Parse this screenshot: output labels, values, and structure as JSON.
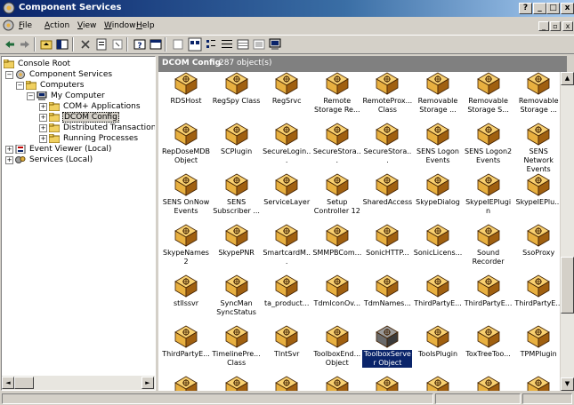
{
  "window": {
    "title": "Component Services",
    "controls": {
      "help": "?",
      "minimize": "_",
      "maximize": "□",
      "close": "x"
    }
  },
  "menu": {
    "items": [
      {
        "label": "File",
        "underline": "F",
        "rest": "ile"
      },
      {
        "label": "Action",
        "underline": "A",
        "rest": "ction"
      },
      {
        "label": "View",
        "underline": "V",
        "rest": "iew"
      },
      {
        "label": "Window",
        "underline": "W",
        "rest": "indow"
      },
      {
        "label": "Help",
        "underline": "H",
        "rest": "elp"
      }
    ],
    "mdi": {
      "minimize": "_",
      "restore": "▫",
      "close": "x"
    }
  },
  "toolbar": {
    "icons": [
      "back-icon",
      "forward-icon",
      "up-folder-icon",
      "show-tree-icon",
      "delete-icon",
      "properties-icon",
      "refresh-icon",
      "help-icon",
      "console-icon",
      "new-window-icon",
      "large-icons-icon",
      "small-icons-icon",
      "list-view-icon",
      "detail-view-icon",
      "status-icon",
      "computer-icon"
    ]
  },
  "tree": {
    "items": [
      {
        "label": "Console Root",
        "level": 0,
        "icon": "folder",
        "expander": ""
      },
      {
        "label": "Component Services",
        "level": 1,
        "icon": "gear",
        "expander": "−"
      },
      {
        "label": "Computers",
        "level": 2,
        "icon": "folder",
        "expander": "−"
      },
      {
        "label": "My Computer",
        "level": 3,
        "icon": "computer",
        "expander": "−"
      },
      {
        "label": "COM+ Applications",
        "level": 4,
        "icon": "folder",
        "expander": "+"
      },
      {
        "label": "DCOM Config",
        "level": 4,
        "icon": "folder",
        "expander": "+",
        "selected": true
      },
      {
        "label": "Distributed Transaction C",
        "level": 4,
        "icon": "folder",
        "expander": "+"
      },
      {
        "label": "Running Processes",
        "level": 4,
        "icon": "folder",
        "expander": "+"
      },
      {
        "label": "Event Viewer (Local)",
        "level": 0,
        "icon": "event",
        "expander": "+"
      },
      {
        "label": "Services (Local)",
        "level": 0,
        "icon": "services",
        "expander": "+"
      }
    ]
  },
  "list": {
    "title": "DCOM Config",
    "count": "287 object(s)",
    "items": [
      "RDSHost",
      "RegSpy Class",
      "RegSrvc",
      "Remote Storage Re...",
      "RemoteProx... Class",
      "Removable Storage ...",
      "Removable Storage S...",
      "Removable Storage ...",
      "RepDoseMDB Object",
      "SCPlugin",
      "SecureLogin...",
      "SecureStora...",
      "SecureStora...",
      "SENS Logon Events",
      "SENS Logon2 Events",
      "SENS Network Events",
      "SENS OnNow Events",
      "SENS Subscriber ...",
      "ServiceLayer",
      "Setup Controller 12",
      "SharedAccess",
      "SkypeDialog",
      "SkypeIEPlugin",
      "SkypeIEPlu...",
      "SkypeNames2",
      "SkypePNR",
      "SmartcardM...",
      "SMMPBCom...",
      "SonicHTTP...",
      "SonicLicens...",
      "Sound Recorder",
      "SsoProxy",
      "stllssvr",
      "SyncMan SyncStatus",
      "ta_product...",
      "TdmIconOv...",
      "TdmNames...",
      "ThirdPartyE...",
      "ThirdPartyE...",
      "ThirdPartyE...",
      "ThirdPartyE...",
      "TimelinePre... Class",
      "TlntSvr",
      "ToolboxEnd... Object",
      "ToolboxServer Object",
      "ToolsPlugin",
      "ToxTreeToo...",
      "TPMPlugin",
      "",
      "",
      "",
      "",
      "",
      "",
      "",
      ""
    ],
    "selected_index": 44
  },
  "scrollbar": {
    "up": "▲",
    "down": "▼",
    "left": "◄",
    "right": "►"
  },
  "colors": {
    "titlebar": "#0a246a",
    "selection": "#0a246a",
    "box": "#e8b040"
  }
}
